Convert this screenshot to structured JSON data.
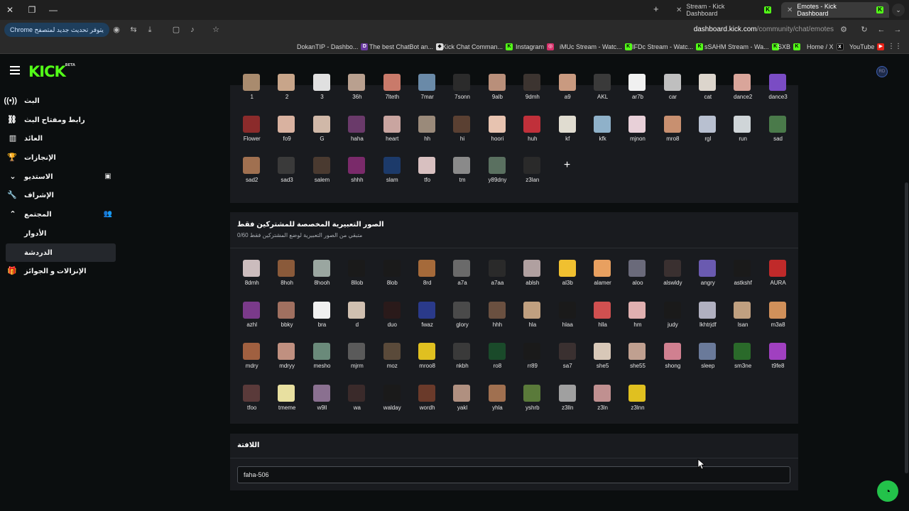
{
  "browser": {
    "tabs": [
      {
        "title": "Stream - Kick Dashboard",
        "active": false
      },
      {
        "title": "Emotes - Kick Dashboard",
        "active": true
      }
    ],
    "update_label": "يتوفر تحديث جديد لمتصفح Chrome",
    "url_host": "dashboard.kick.com",
    "url_path": "/community/chat/emotes",
    "bookmarks": [
      "DokanTIP - Dashbo...",
      "The best ChatBot an...",
      "Kick Chat Comman...",
      "Instagram",
      "iMUc Stream - Watc...",
      "IFDc Stream - Watc...",
      "sSAHM Stream - Wa...",
      "SXB",
      "Home / X",
      "YouTube"
    ]
  },
  "app": {
    "logo": "KICK",
    "logo_badge": "BETA",
    "avatar_initials": "RD"
  },
  "sidebar": {
    "items": [
      {
        "label": "البث",
        "icon": "broadcast-icon",
        "glyph": "((•))"
      },
      {
        "label": "رابط ومفتاح البث",
        "icon": "link-icon",
        "glyph": "⛓"
      },
      {
        "label": "العائد",
        "icon": "bar-chart-icon",
        "glyph": "▥"
      },
      {
        "label": "الإنجازات",
        "icon": "trophy-icon",
        "glyph": "🏆"
      },
      {
        "label": "الاستديو",
        "icon": "studio-icon",
        "glyph": "⌄",
        "action": "▣"
      },
      {
        "label": "الإشراف",
        "icon": "wrench-icon",
        "glyph": "🔧"
      },
      {
        "label": "المجتمع",
        "icon": "community-icon",
        "glyph": "⌃",
        "action": "👥"
      }
    ],
    "sub_items": [
      {
        "label": "الأدوار",
        "active": false
      },
      {
        "label": "الدردشة",
        "active": true
      }
    ],
    "last_item": {
      "label": "الإنزالات و الجوائز",
      "icon": "gift-icon",
      "glyph": "🎁"
    }
  },
  "emotes_public": {
    "labels": [
      "1",
      "2",
      "3",
      "36h",
      "7lteth",
      "7mar",
      "7sonn",
      "9alb",
      "9dmh",
      "a9",
      "AKL",
      "ar7b",
      "car",
      "cat",
      "dance2",
      "dance3",
      "Flower",
      "fo9",
      "G",
      "haha",
      "heart",
      "hh",
      "hi",
      "hoori",
      "huh",
      "kf",
      "kfk",
      "mjnon",
      "mro8",
      "rgl",
      "run",
      "sad",
      "sad2",
      "sad3",
      "salem",
      "shhh",
      "slam",
      "tfo",
      "tm",
      "y89dny",
      "z3lan"
    ],
    "colors": [
      "#a98b6e",
      "#c8a58a",
      "#e0e0e0",
      "#b9a08f",
      "#c97a6a",
      "#6a8aa8",
      "#2b2b2b",
      "#b98f7a",
      "#3c3430",
      "#c99a80",
      "#3a3a3a",
      "#f0f0f0",
      "#bfbfbf",
      "#dcd5cc",
      "#d9a59a",
      "#7a4cc4",
      "#8b2b2b",
      "#d9b2a0",
      "#d0b8a8",
      "#6a3a6a",
      "#c9a5a0",
      "#9a8a7a",
      "#5a4032",
      "#e7c3b0",
      "#c0303a",
      "#e0dcd0",
      "#8fb1c9",
      "#e8d0d8",
      "#c89070",
      "#b8c0d0",
      "#cfd5d8",
      "#4a7a4a",
      "#a07050",
      "#3a3a3a",
      "#4a3a30",
      "#7a2a6a",
      "#1c3a6a",
      "#d8c0c0",
      "#8a8a8a",
      "#5a7060",
      "#2a2a2a"
    ],
    "add_label": "+"
  },
  "emotes_subscribers": {
    "title": "الصور التعبيرية المخصصة للمشتركين فقط",
    "subtitle": "متبقي من الصور التعبيرية لوضع المشتركين فقط 0/60",
    "labels": [
      "8dmh",
      "8hoh",
      "8hooh",
      "8llob",
      "8lob",
      "8rd",
      "a7a",
      "a7aa",
      "ablsh",
      "al3b",
      "alamer",
      "aloo",
      "alswldy",
      "angry",
      "astkshf",
      "AURA",
      "azhl",
      "bbky",
      "bra",
      "d",
      "duo",
      "fwaz",
      "glory",
      "hhh",
      "hla",
      "hlaa",
      "hlla",
      "hm",
      "judy",
      "lkhtrjdf",
      "lsan",
      "m3a8",
      "mdry",
      "mdryy",
      "mesho",
      "mjrm",
      "moz",
      "mroo8",
      "nkbh",
      "ro8",
      "rr89",
      "sa7",
      "she5",
      "she55",
      "shong",
      "sleep",
      "sm3ne",
      "t9fe8",
      "tfoo",
      "tmeme",
      "w9ll",
      "wa",
      "walday",
      "wordh",
      "yakl",
      "yhla",
      "yshrb",
      "z3lln",
      "z3ln",
      "z3lnn"
    ],
    "colors": [
      "#cbbcbd",
      "#8a5a3a",
      "#9aa6a0",
      "#1a1a1a",
      "#1a1a1a",
      "#a56a3a",
      "#6a6a6a",
      "#2a2a2a",
      "#b0a0a0",
      "#f0c030",
      "#e8a060",
      "#6a6a7a",
      "#3a3030",
      "#6a5ab0",
      "#1a1a1a",
      "#c02a2a",
      "#7a3a8a",
      "#a07060",
      "#f0f0f0",
      "#d0c0b0",
      "#2a1a1a",
      "#2a3a8a",
      "#4a4a4a",
      "#6a5040",
      "#c0a080",
      "#1a1a1a",
      "#d05050",
      "#e0b0b0",
      "#1a1a1a",
      "#b0b0c0",
      "#c0a080",
      "#d0905a",
      "#a06040",
      "#c09080",
      "#6a8a7a",
      "#5a5a5a",
      "#5a4a3a",
      "#e0c020",
      "#3a3a3a",
      "#1a4a2a",
      "#1a1a1a",
      "#3a3030",
      "#d8c8b8",
      "#c0a090",
      "#d08090",
      "#6a7a9a",
      "#2a6a2a",
      "#a040c0",
      "#5a3a3a",
      "#e8e0a0",
      "#8a7090",
      "#3a2a2a",
      "#1a1a1a",
      "#6a3a2a",
      "#b09080",
      "#a07050",
      "#5a7a3a",
      "#a0a0a0",
      "#c09090",
      "#e0c020"
    ],
    "green_glyph_index": 40
  },
  "banner": {
    "title": "اللافتة",
    "value": "faha-506"
  }
}
